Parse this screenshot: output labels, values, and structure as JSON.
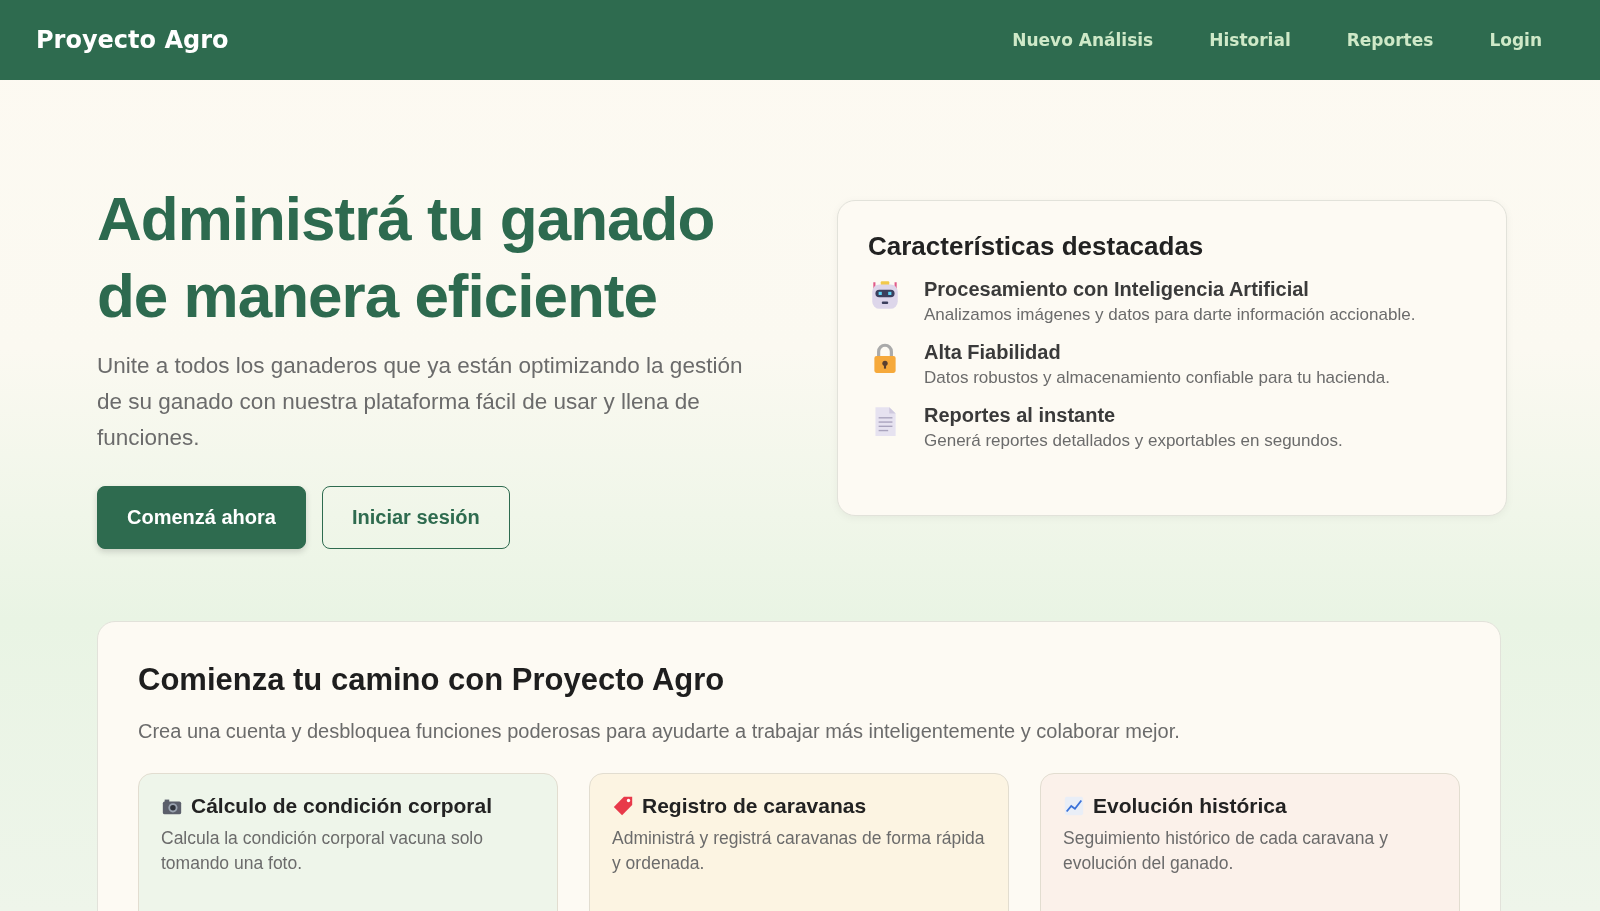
{
  "navbar": {
    "brand": "Proyecto Agro",
    "links": [
      "Nuevo Análisis",
      "Historial",
      "Reportes",
      "Login"
    ]
  },
  "hero": {
    "title_lines": [
      "Administrá tu ganado",
      "de manera eficiente"
    ],
    "subtitle": "Unite a todos los ganaderos que ya están optimizando la gestión de su ganado con nuestra plataforma fácil de usar y llena de funciones.",
    "buttons": [
      {
        "label": "Comenzá ahora",
        "kind": "primary"
      },
      {
        "label": "Iniciar sesión",
        "kind": "secondary"
      }
    ]
  },
  "features_card": {
    "title": "Características destacadas",
    "items": [
      {
        "kind": "robot",
        "title": "Procesamiento con Inteligencia Artificial",
        "description": "Analizamos imágenes y datos para darte información accionable."
      },
      {
        "kind": "lock",
        "title": "Alta Fiabilidad",
        "description": "Datos robustos y almacenamiento confiable para tu hacienda."
      },
      {
        "kind": "document",
        "title": "Reportes al instante",
        "description": "Generá reportes detallados y exportables en segundos."
      }
    ]
  },
  "start_section": {
    "title": "Comienza tu camino con Proyecto Agro",
    "description": "Crea una cuenta y desbloquea funciones poderosas para ayudarte a trabajar más inteligentemente y colaborar mejor.",
    "cards": [
      {
        "kind": "camera",
        "color": "#eef5ea",
        "title": "Cálculo de condición corporal",
        "description": "Calcula la condición corporal vacuna solo tomando una foto."
      },
      {
        "kind": "tag",
        "color": "#fcf4e2",
        "title": "Registro de caravanas",
        "description": "Administrá y registrá caravanas de forma rápida y ordenada."
      },
      {
        "kind": "chart",
        "color": "#fbf1ea",
        "title": "Evolución histórica",
        "description": "Seguimiento histórico de cada caravana y evolución del ganado."
      }
    ]
  }
}
